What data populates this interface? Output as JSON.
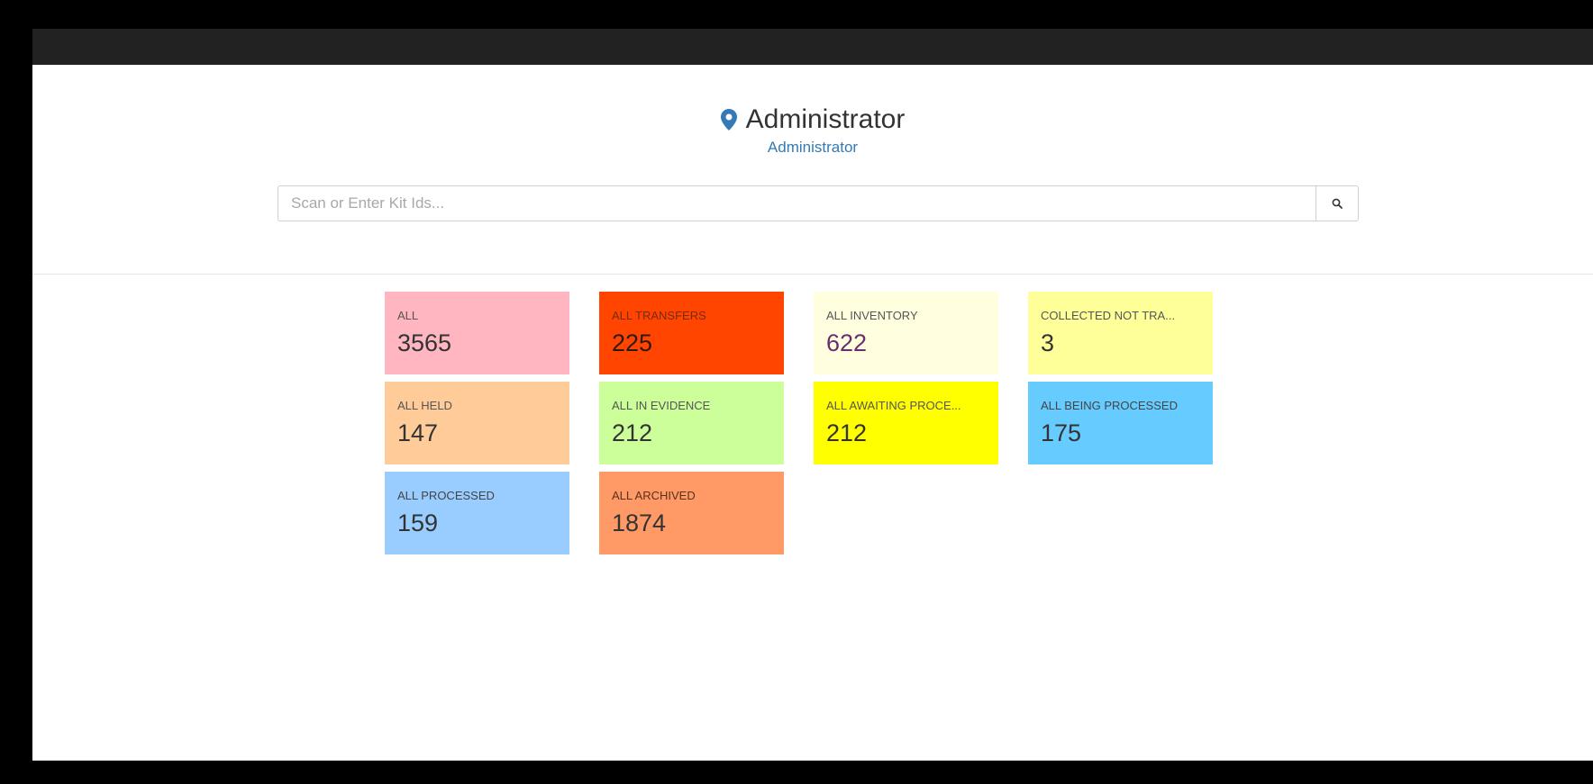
{
  "header": {
    "title": "Administrator",
    "subtitle": "Administrator",
    "icon": "map-marker-icon"
  },
  "search": {
    "placeholder": "Scan or Enter Kit Ids...",
    "value": "",
    "button_icon": "search-icon"
  },
  "colors": {
    "topbar": "#222222",
    "accent": "#337ab7"
  },
  "tiles": [
    {
      "label": "ALL",
      "count": "3565",
      "color": "#ffb6c1",
      "label_color": "#555555",
      "count_color": "#333333"
    },
    {
      "label": "ALL TRANSFERS",
      "count": "225",
      "color": "#ff4500",
      "label_color": "#7a2a10",
      "count_color": "#2b1b14"
    },
    {
      "label": "ALL INVENTORY",
      "count": "622",
      "color": "#ffffe0",
      "label_color": "#555555",
      "count_color": "#6b2d6b"
    },
    {
      "label": "COLLECTED NOT TRA...",
      "count": "3",
      "color": "#ffff99",
      "label_color": "#555555",
      "count_color": "#333333"
    },
    {
      "label": "ALL HELD",
      "count": "147",
      "color": "#ffcc99",
      "label_color": "#555555",
      "count_color": "#333333"
    },
    {
      "label": "ALL IN EVIDENCE",
      "count": "212",
      "color": "#ccff99",
      "label_color": "#555555",
      "count_color": "#333333"
    },
    {
      "label": "ALL AWAITING PROCE...",
      "count": "212",
      "color": "#ffff00",
      "label_color": "#555555",
      "count_color": "#333333"
    },
    {
      "label": "ALL BEING PROCESSED",
      "count": "175",
      "color": "#66ccff",
      "label_color": "#444444",
      "count_color": "#333333"
    },
    {
      "label": "ALL PROCESSED",
      "count": "159",
      "color": "#99ccff",
      "label_color": "#444444",
      "count_color": "#333333"
    },
    {
      "label": "ALL ARCHIVED",
      "count": "1874",
      "color": "#ff9966",
      "label_color": "#5a3020",
      "count_color": "#333333"
    }
  ]
}
